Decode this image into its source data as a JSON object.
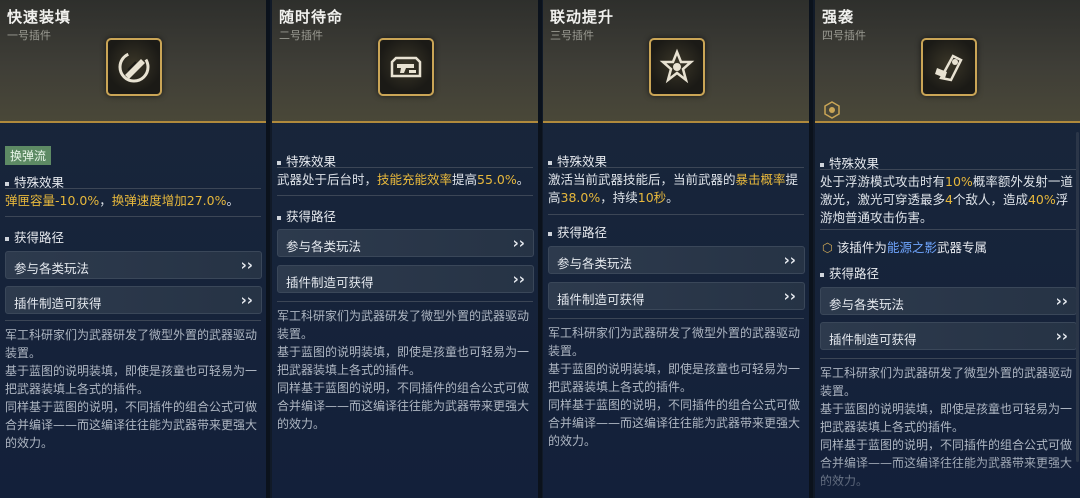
{
  "labels": {
    "special_effect": "特殊效果",
    "acquire_path": "获得路径"
  },
  "colors": {
    "highlight": "#e7b83c",
    "highlight_blue": "#6fa6ff",
    "tag_green": "#5d8a64",
    "frame_gold": "#caa556"
  },
  "lore": [
    "军工科研家们为武器研发了微型外置的武器驱动装置。",
    "基于蓝图的说明装填，即使是孩童也可轻易为一把武器装填上各式的插件。",
    "同样基于蓝图的说明，不同插件的组合公式可做合并编译——而这编译往往能为武器带来更强大的效力。"
  ],
  "cards": [
    {
      "title": "快速装填",
      "subtitle": "一号插件",
      "icon": "bullet-reload-icon",
      "tag": "换弹流",
      "effect": {
        "p1": "弹匣容量",
        "v1": "-10.0%",
        "p2": "，",
        "v2": "换弹速度增加27.0%",
        "p3": "。"
      },
      "buttons": [
        "参与各类玩法",
        "插件制造可获得"
      ]
    },
    {
      "title": "随时待命",
      "subtitle": "二号插件",
      "icon": "gun-standby-icon",
      "effect": {
        "p1": "武器处于后台时，",
        "v1": "技能充能效率",
        "p2": "提高",
        "v2": "55.0%",
        "p3": "。"
      },
      "buttons": [
        "参与各类玩法",
        "插件制造可获得"
      ]
    },
    {
      "title": "联动提升",
      "subtitle": "三号插件",
      "icon": "star-link-icon",
      "effect": {
        "p1": "激活当前武器技能后，当前武器的",
        "v1": "暴击概率",
        "p2": "提高",
        "v2": "38.0%",
        "p3": "，持续",
        "v3": "10秒",
        "p4": "。"
      },
      "buttons": [
        "参与各类玩法",
        "插件制造可获得"
      ]
    },
    {
      "title": "强袭",
      "subtitle": "四号插件",
      "icon": "assault-cannon-icon",
      "effect": {
        "p1": "处于浮游模式攻击时有",
        "v1": "10%",
        "p2": "概率额外发射一道激光，激光可穿透最多",
        "v2": "4",
        "p3": "个敌人，造成",
        "v3": "40%",
        "p4": "浮游炮普通攻击伤害。"
      },
      "exclusive": {
        "prefix": "该插件为",
        "name": "能源之影",
        "suffix": "武器专属"
      },
      "buttons": [
        "参与各类玩法",
        "插件制造可获得"
      ]
    }
  ]
}
